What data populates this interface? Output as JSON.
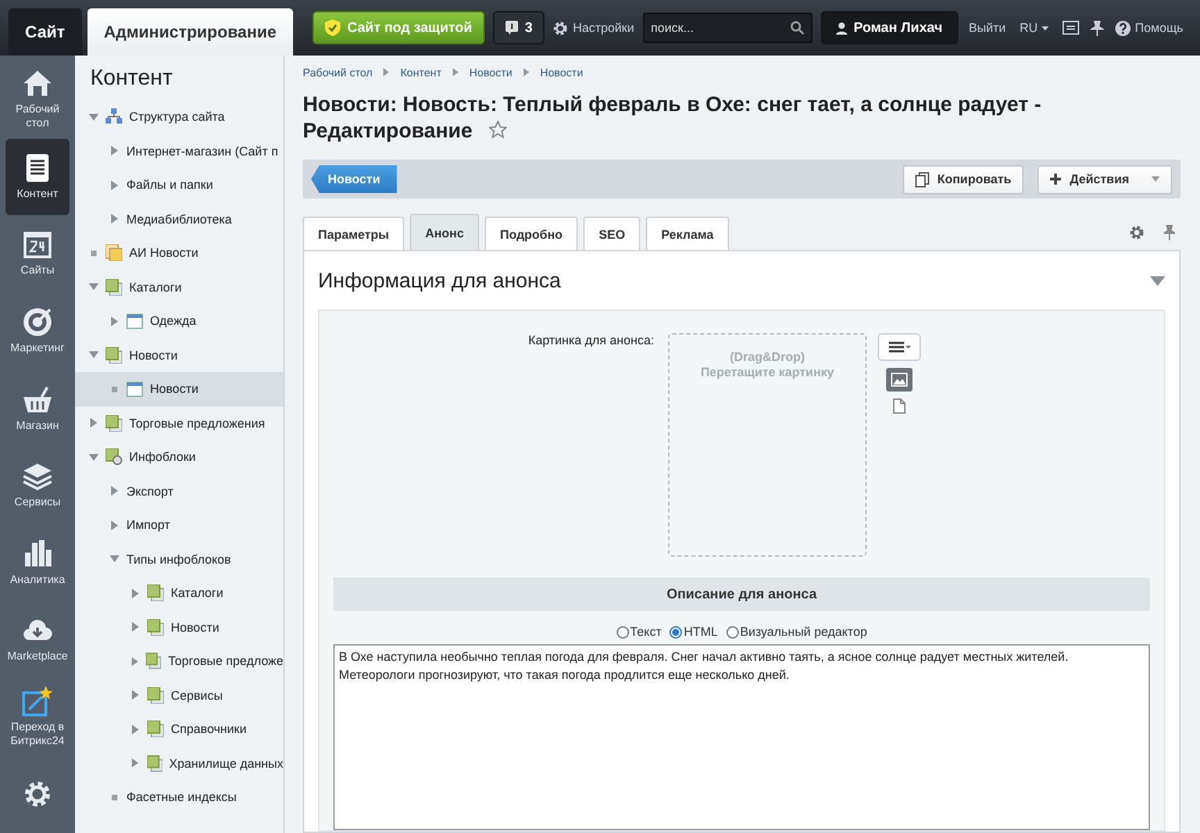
{
  "topbar": {
    "tabs": [
      {
        "label": "Сайт",
        "selected": false
      },
      {
        "label": "Администрирование",
        "selected": true
      }
    ],
    "security_button": "Сайт под защитой",
    "notifications": "3",
    "settings": "Настройки",
    "search": {
      "placeholder": "поиск..."
    },
    "user": "Роман Лихач",
    "logout": "Выйти",
    "language": "RU",
    "help": "Помощь"
  },
  "rail": [
    {
      "kind": "home",
      "label": "Рабочий стол",
      "selected": false
    },
    {
      "kind": "document",
      "label": "Контент",
      "selected": true
    },
    {
      "kind": "calendar",
      "label": "Сайты",
      "selected": false
    },
    {
      "kind": "target",
      "label": "Маркетинг",
      "selected": false
    },
    {
      "kind": "basket",
      "label": "Магазин",
      "selected": false
    },
    {
      "kind": "layers",
      "label": "Сервисы",
      "selected": false
    },
    {
      "kind": "bars",
      "label": "Аналитика",
      "selected": false
    },
    {
      "kind": "cloud",
      "label": "Marketplace",
      "selected": false
    },
    {
      "kind": "wand",
      "label": "Переход в Битрикс24",
      "selected": false
    },
    {
      "kind": "gear",
      "selected": false
    }
  ],
  "tree": {
    "title": "Контент",
    "items": [
      {
        "label": "Структура сайта",
        "expanded": true,
        "kind": "structure",
        "selected": false,
        "children": [
          {
            "label": "Интернет-магазин (Сайт п",
            "expanded": false,
            "kind": "plain",
            "selected": false
          },
          {
            "label": "Файлы и папки",
            "expanded": false,
            "kind": "plain",
            "selected": false
          },
          {
            "label": "Медиабиблиотека",
            "expanded": false,
            "kind": "plain",
            "selected": false
          }
        ]
      },
      {
        "label": "АИ Новости",
        "kind": "folder",
        "selected": false
      },
      {
        "label": "Каталоги",
        "expanded": true,
        "kind": "block",
        "selected": false,
        "children": [
          {
            "label": "Одежда",
            "expanded": false,
            "kind": "window",
            "selected": false
          }
        ]
      },
      {
        "label": "Новости",
        "expanded": true,
        "kind": "block",
        "selected": false,
        "children": [
          {
            "label": "Новости",
            "kind": "window",
            "selected": true
          }
        ]
      },
      {
        "label": "Торговые предложения",
        "expanded": false,
        "kind": "block",
        "selected": false
      },
      {
        "label": "Инфоблоки",
        "expanded": true,
        "kind": "infoblocks",
        "selected": false,
        "children": [
          {
            "label": "Экспорт",
            "expanded": false,
            "kind": "plain",
            "selected": false
          },
          {
            "label": "Импорт",
            "expanded": false,
            "kind": "plain",
            "selected": false
          },
          {
            "label": "Типы инфоблоков",
            "expanded": true,
            "kind": "plain",
            "selected": false,
            "children": [
              {
                "label": "Каталоги",
                "expanded": false,
                "kind": "block",
                "selected": false
              },
              {
                "label": "Новости",
                "expanded": false,
                "kind": "block",
                "selected": false
              },
              {
                "label": "Торговые предложе",
                "expanded": false,
                "kind": "block",
                "selected": false
              },
              {
                "label": "Сервисы",
                "expanded": false,
                "kind": "block",
                "selected": false
              },
              {
                "label": "Справочники",
                "expanded": false,
                "kind": "block",
                "selected": false
              },
              {
                "label": "Хранилище данных",
                "expanded": false,
                "kind": "block",
                "selected": false
              }
            ]
          },
          {
            "label": "Фасетные индексы",
            "kind": "plain",
            "selected": false
          }
        ]
      }
    ]
  },
  "breadcrumbs": [
    "Рабочий стол",
    "Контент",
    "Новости",
    "Новости"
  ],
  "title": "Новости: Новость: Теплый февраль в Охе: снег тает, а солнце радует - Редактирование",
  "favorite": false,
  "toolbar": {
    "back": "Новости",
    "copy": "Копировать",
    "actions": "Действия"
  },
  "tabs": [
    {
      "label": "Параметры",
      "selected": false
    },
    {
      "label": "Анонс",
      "selected": true
    },
    {
      "label": "Подробно",
      "selected": false
    },
    {
      "label": "SEO",
      "selected": false
    },
    {
      "label": "Реклама",
      "selected": false
    }
  ],
  "section": {
    "title": "Информация для анонса",
    "expanded": true,
    "image_label": "Картинка для анонса:",
    "dropzone": [
      "(Drag&Drop)",
      "Перетащите картинку"
    ],
    "description_title": "Описание для анонса",
    "formats": [
      {
        "label": "Текст",
        "selected": false
      },
      {
        "label": "HTML",
        "selected": true
      },
      {
        "label": "Визуальный редактор",
        "selected": false
      }
    ],
    "text": "В Охе наступила необычно теплая погода для февраля. Снег начал активно таять, а ясное солнце радует местных жителей. Метеорологи прогнозируют, что такая погода продлится еще несколько дней."
  }
}
